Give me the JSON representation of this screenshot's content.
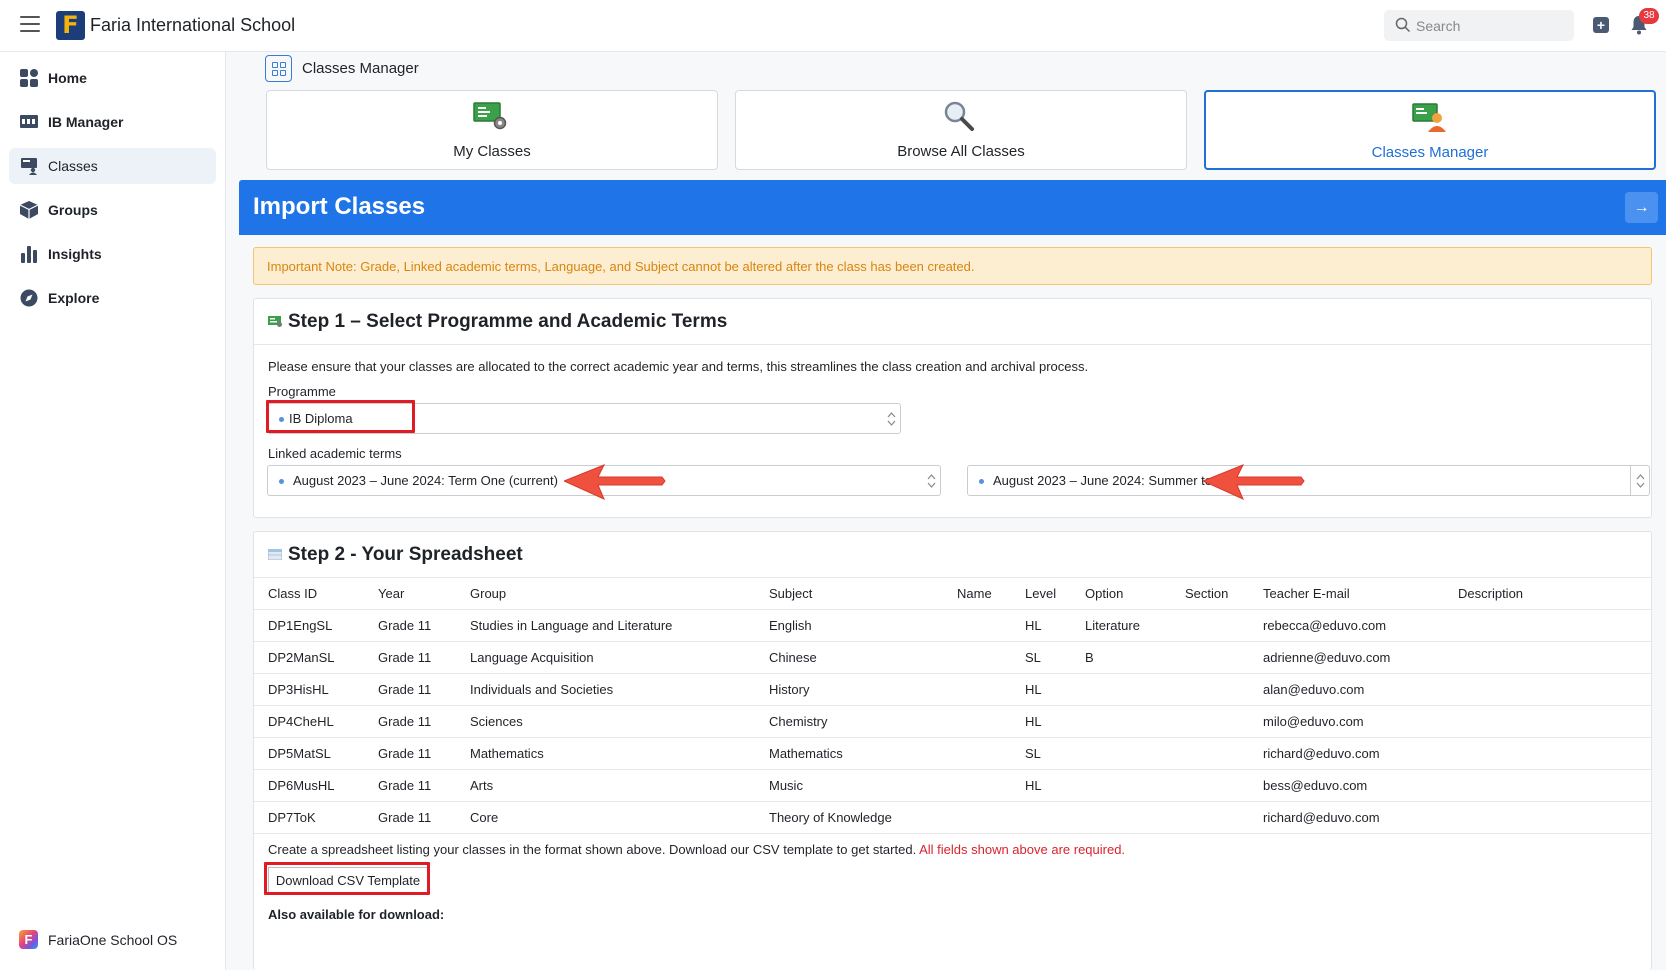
{
  "header": {
    "logo_letter": "F",
    "school_name": "Faria International School",
    "search_placeholder": "Search",
    "notifications_count": "38"
  },
  "sidebar": {
    "items": [
      {
        "label": "Home",
        "icon": "home-icon"
      },
      {
        "label": "IB Manager",
        "icon": "ib-manager-icon"
      },
      {
        "label": "Classes",
        "icon": "classes-icon",
        "active": true
      },
      {
        "label": "Groups",
        "icon": "groups-icon"
      },
      {
        "label": "Insights",
        "icon": "insights-icon"
      },
      {
        "label": "Explore",
        "icon": "explore-icon"
      }
    ],
    "footer_label": "FariaOne School OS",
    "footer_letter": "F"
  },
  "page": {
    "section_title": "Classes Manager",
    "tabs": [
      {
        "label": "My Classes",
        "icon": "my-classes-icon"
      },
      {
        "label": "Browse All Classes",
        "icon": "magnifier-icon"
      },
      {
        "label": "Classes Manager",
        "icon": "classes-manager-icon",
        "active": true
      }
    ],
    "import_title": "Import Classes",
    "import_button": "→",
    "note": "Important Note: Grade, Linked academic terms, Language, and Subject cannot be altered after the class has been created."
  },
  "step1": {
    "title": "Step 1 – Select Programme and Academic Terms",
    "description": "Please ensure that your classes are allocated to the correct academic year and terms, this streamlines the class creation and archival process.",
    "programme_label": "Programme",
    "programme_value": "IB Diploma",
    "terms_label": "Linked academic terms",
    "term_one": "August 2023 – June 2024: Term One (current)",
    "term_two": "August 2023 – June 2024: Summer term"
  },
  "step2": {
    "title": "Step 2 - Your Spreadsheet",
    "columns": [
      "Class ID",
      "Year",
      "Group",
      "Subject",
      "Name",
      "Level",
      "Option",
      "Section",
      "Teacher E-mail",
      "Description"
    ],
    "rows": [
      [
        "DP1EngSL",
        "Grade 11",
        "Studies in Language and Literature",
        "English",
        "",
        "HL",
        "Literature",
        "",
        "rebecca@eduvo.com",
        ""
      ],
      [
        "DP2ManSL",
        "Grade 11",
        "Language Acquisition",
        "Chinese",
        "",
        "SL",
        "B",
        "",
        "adrienne@eduvo.com",
        ""
      ],
      [
        "DP3HisHL",
        "Grade 11",
        "Individuals and Societies",
        "History",
        "",
        "HL",
        "",
        "",
        "alan@eduvo.com",
        ""
      ],
      [
        "DP4CheHL",
        "Grade 11",
        "Sciences",
        "Chemistry",
        "",
        "HL",
        "",
        "",
        "milo@eduvo.com",
        ""
      ],
      [
        "DP5MatSL",
        "Grade 11",
        "Mathematics",
        "Mathematics",
        "",
        "SL",
        "",
        "",
        "richard@eduvo.com",
        ""
      ],
      [
        "DP6MusHL",
        "Grade 11",
        "Arts",
        "Music",
        "",
        "HL",
        "",
        "",
        "bess@eduvo.com",
        ""
      ],
      [
        "DP7ToK",
        "Grade 11",
        "Core",
        "Theory of Knowledge",
        "",
        "",
        "",
        "",
        "richard@eduvo.com",
        ""
      ]
    ],
    "footer_text": "Create a spreadsheet listing your classes in the format shown above. Download our CSV template to get started.",
    "footer_required": "All fields shown above are required.",
    "download_button": "Download CSV Template",
    "also_available": "Also available for download:"
  },
  "colors": {
    "accent": "#1f74e8",
    "highlight": "#e01b24",
    "arrow": "#f0513f",
    "warning_text": "#d8860f",
    "required_text": "#d9232e"
  }
}
